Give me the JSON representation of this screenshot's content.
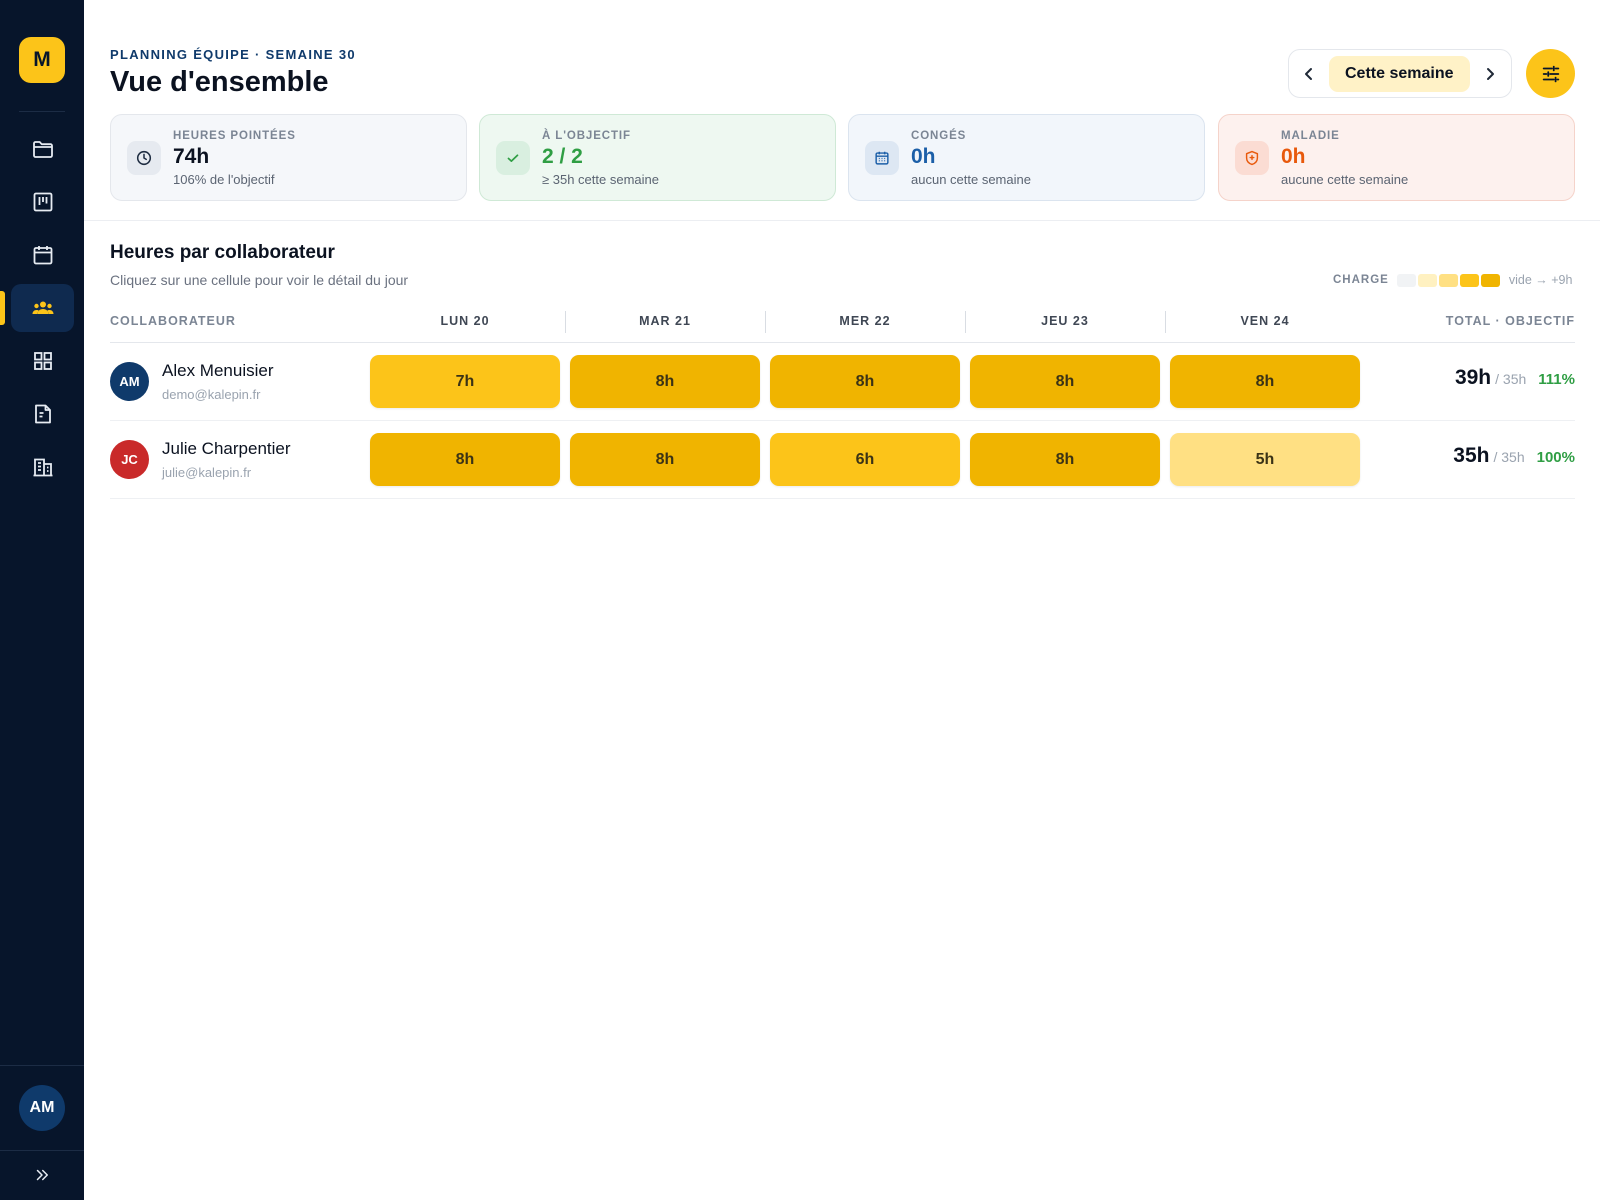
{
  "sidebar": {
    "logo": "M",
    "nav": [
      {
        "id": "projects",
        "icon": "folder-icon"
      },
      {
        "id": "board",
        "icon": "kanban-icon"
      },
      {
        "id": "calendar",
        "icon": "calendar-icon"
      },
      {
        "id": "team",
        "icon": "team-icon",
        "active": true
      },
      {
        "id": "dashboard",
        "icon": "grid-icon"
      },
      {
        "id": "documents",
        "icon": "document-icon"
      },
      {
        "id": "companies",
        "icon": "building-icon"
      }
    ],
    "user_initials": "AM",
    "expand_icon": "chevrons-right-icon"
  },
  "header": {
    "eyebrow": "PLANNING ÉQUIPE · SEMAINE 30",
    "title": "Vue d'ensemble",
    "week_label": "Cette semaine",
    "prev_icon": "chevron-left-icon",
    "next_icon": "chevron-right-icon",
    "filter_icon": "sliders-icon"
  },
  "stats": [
    {
      "label": "HEURES POINTÉES",
      "value": "74h",
      "sub": "106% de l'objectif",
      "icon": "clock-icon",
      "value_color": "#0b1220"
    },
    {
      "label": "À L'OBJECTIF",
      "value": "2 / 2",
      "sub": "≥ 35h cette semaine",
      "icon": "check-icon",
      "value_color": "#2f9e44"
    },
    {
      "label": "CONGÉS",
      "value": "0h",
      "sub": "aucun cette semaine",
      "icon": "calendar-icon",
      "value_color": "#1c5fa8"
    },
    {
      "label": "MALADIE",
      "value": "0h",
      "sub": "aucune cette semaine",
      "icon": "shield-icon",
      "value_color": "#e8590c"
    }
  ],
  "section": {
    "title": "Heures par collaborateur",
    "subtitle": "Cliquez sur une cellule pour voir le détail du jour",
    "legend_label": "CHARGE",
    "legend_range": "vide → +9h",
    "legend_colors": [
      "#f1f3f5",
      "#fff1c1",
      "#ffe083",
      "#fcc419",
      "#f0b400"
    ]
  },
  "table": {
    "headers": {
      "employee": "COLLABORATEUR",
      "days": [
        "LUN 20",
        "MAR 21",
        "MER 22",
        "JEU 23",
        "VEN 24"
      ],
      "total": "TOTAL · OBJECTIF"
    },
    "rows": [
      {
        "initials": "AM",
        "avatar_color": "#0f3a6b",
        "name": "Alex Menuisier",
        "email": "demo@kalepin.fr",
        "hours": [
          "7h",
          "8h",
          "8h",
          "8h",
          "8h"
        ],
        "hour_values": [
          7,
          8,
          8,
          8,
          8
        ],
        "total": "39h",
        "objective": "/ 35h",
        "pct": "111%"
      },
      {
        "initials": "JC",
        "avatar_color": "#c92a2a",
        "name": "Julie Charpentier",
        "email": "julie@kalepin.fr",
        "hours": [
          "8h",
          "8h",
          "6h",
          "8h",
          "5h"
        ],
        "hour_values": [
          8,
          8,
          6,
          8,
          5
        ],
        "total": "35h",
        "objective": "/ 35h",
        "pct": "100%"
      }
    ]
  }
}
